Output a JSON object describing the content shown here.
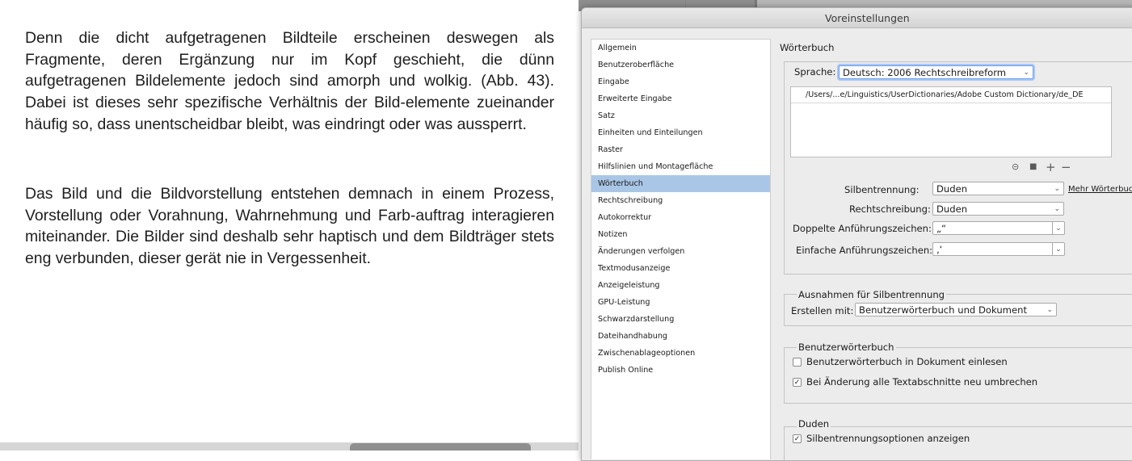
{
  "document": {
    "paragraph1": "Denn die dicht aufgetragenen Bildteile erscheinen deswegen als Fragmente, deren Ergänzung nur im Kopf geschieht, die dünn aufgetragenen Bildelemente jedoch sind amorph und wolkig. (Abb. 43). Dabei ist dieses sehr spezifische Verhältnis der Bild-elemente zueinander häufig so, dass unentscheidbar bleibt, was eindringt oder was aussperrt.",
    "paragraph2": "Das Bild und die Bildvorstellung entstehen demnach in einem Prozess, Vorstellung oder Vorahnung, Wahrnehmung und Farb-auftrag interagieren miteinander. Die Bilder sind deshalb sehr haptisch und dem Bildträger stets eng verbunden, dieser gerät nie in Vergessenheit."
  },
  "dialog": {
    "title": "Voreinstellungen",
    "sidebar": {
      "items": [
        {
          "label": "Allgemein"
        },
        {
          "label": "Benutzeroberfläche"
        },
        {
          "label": "Eingabe"
        },
        {
          "label": "Erweiterte Eingabe"
        },
        {
          "label": "Satz"
        },
        {
          "label": "Einheiten und Einteilungen"
        },
        {
          "label": "Raster"
        },
        {
          "label": "Hilfslinien und Montagefläche"
        },
        {
          "label": "Wörterbuch"
        },
        {
          "label": "Rechtschreibung"
        },
        {
          "label": "Autokorrektur"
        },
        {
          "label": "Notizen"
        },
        {
          "label": "Änderungen verfolgen"
        },
        {
          "label": "Textmodusanzeige"
        },
        {
          "label": "Anzeigeleistung"
        },
        {
          "label": "GPU-Leistung"
        },
        {
          "label": "Schwarzdarstellung"
        },
        {
          "label": "Dateihandhabung"
        },
        {
          "label": "Zwischenablageoptionen"
        },
        {
          "label": "Publish Online"
        }
      ],
      "selected": "Wörterbuch"
    },
    "panel": {
      "heading": "Wörterbuch",
      "language_label": "Sprache:",
      "language_value": "Deutsch: 2006 Rechtschreibreform",
      "dictionary_path": "/Users/...e/Linguistics/UserDictionaries/Adobe Custom Dictionary/de_DE",
      "hyphenation_label": "Silbentrennung:",
      "hyphenation_value": "Duden",
      "more_dictionaries_link": "Mehr Wörterbuch",
      "spelling_label": "Rechtschreibung:",
      "spelling_value": "Duden",
      "double_quotes_label": "Doppelte Anführungszeichen:",
      "double_quotes_value": "„“",
      "single_quotes_label": "Einfache Anführungszeichen:",
      "single_quotes_value": "‚‘",
      "hyphen_exceptions": {
        "title": "Ausnahmen für Silbentrennung",
        "compose_label": "Erstellen mit:",
        "compose_value": "Benutzerwörterbuch und Dokument"
      },
      "user_dictionary": {
        "title": "Benutzerwörterbuch",
        "merge_into_document": {
          "label": "Benutzerwörterbuch in Dokument einlesen",
          "checked": false
        },
        "recompose_on_change": {
          "label": "Bei Änderung alle Textabschnitte neu umbrechen",
          "checked": true
        }
      },
      "duden": {
        "title": "Duden",
        "show_hyphenation_options": {
          "label": "Silbentrennungsoptionen anzeigen",
          "checked": true
        }
      }
    }
  },
  "colors": {
    "selection": "#aac6e6",
    "focus_ring": "#6a9ff2",
    "dialog_bg": "#ececec"
  }
}
